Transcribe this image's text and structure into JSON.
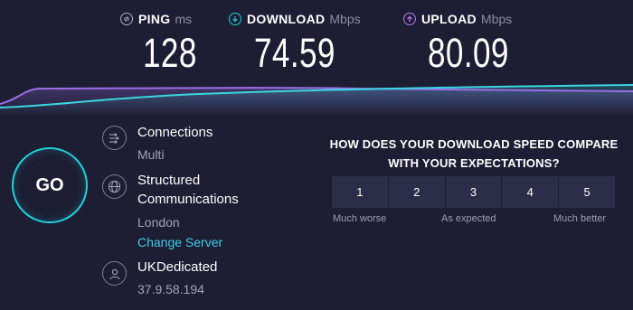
{
  "metrics": {
    "ping": {
      "label": "PING",
      "unit": "ms",
      "value": "128",
      "icon": "ping-icon",
      "color": "#aeb0c3"
    },
    "download": {
      "label": "DOWNLOAD",
      "unit": "Mbps",
      "value": "74.59",
      "icon": "download-icon",
      "color": "#1fd1d9"
    },
    "upload": {
      "label": "UPLOAD",
      "unit": "Mbps",
      "value": "80.09",
      "icon": "upload-icon",
      "color": "#b47cf0"
    }
  },
  "graph": {
    "download_color": "#3ad6e0",
    "upload_color": "#9c6ee8"
  },
  "go_button": {
    "label": "GO",
    "color": "#1fd1d9"
  },
  "connections": {
    "title": "Connections",
    "value": "Multi",
    "icon": "connections-icon"
  },
  "server": {
    "name_line1": "Structured",
    "name_line2": "Communications",
    "location": "London",
    "change_label": "Change Server",
    "icon": "globe-icon"
  },
  "provider": {
    "name": "UKDedicated",
    "ip": "37.9.58.194",
    "icon": "user-icon"
  },
  "survey": {
    "question_line1": "HOW DOES YOUR DOWNLOAD SPEED COMPARE",
    "question_line2": "WITH YOUR EXPECTATIONS?",
    "options": [
      "1",
      "2",
      "3",
      "4",
      "5"
    ],
    "scale_low": "Much worse",
    "scale_mid": "As expected",
    "scale_high": "Much better"
  },
  "colors": {
    "background": "#1d1d33",
    "accent": "#1fd1d9",
    "link": "#3fd0e8",
    "button_bg": "#2c2d48"
  }
}
